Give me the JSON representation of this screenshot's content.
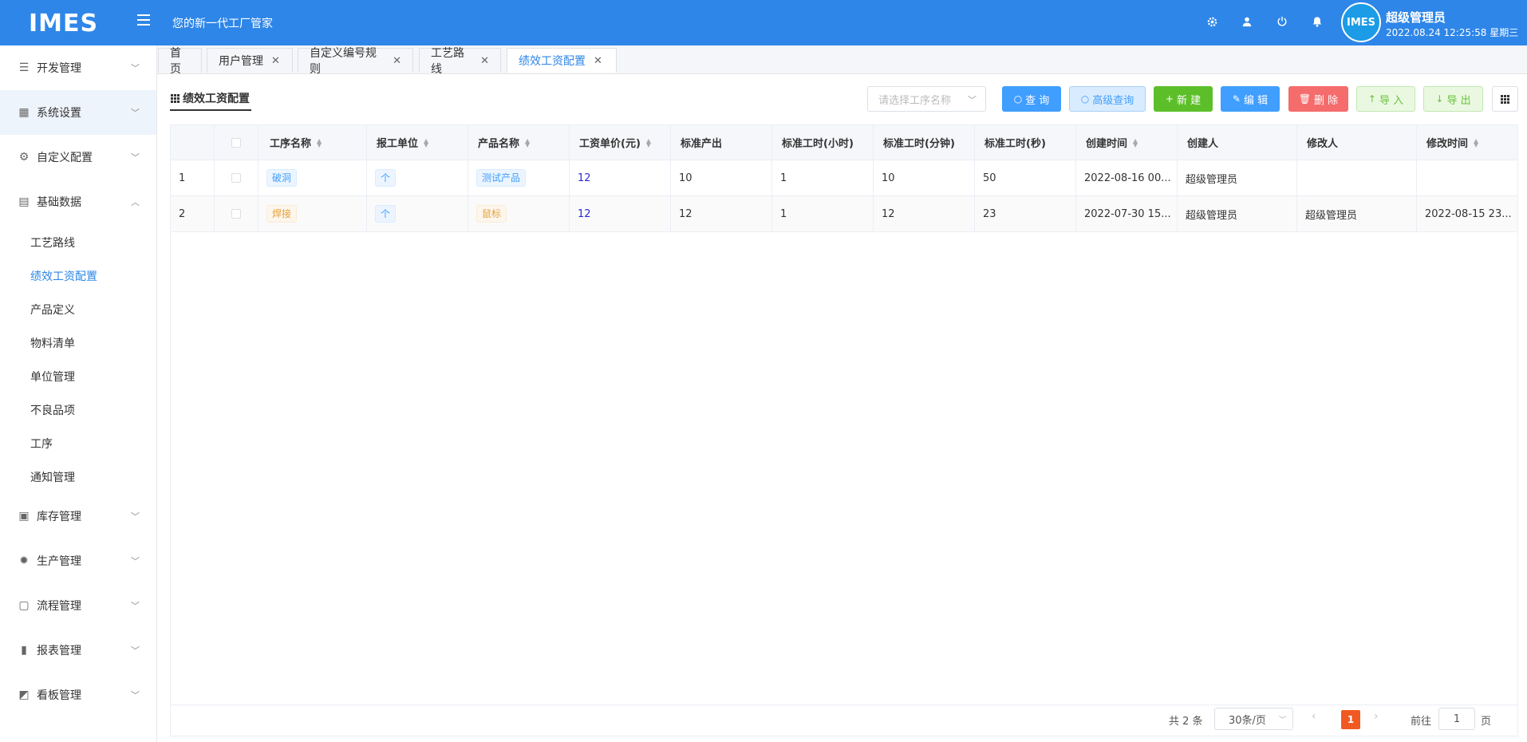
{
  "header": {
    "logo": "IMES",
    "slogan": "您的新一代工厂管家",
    "avatar_text": "IMES",
    "user_name": "超级管理员",
    "datetime": "2022.08.24 12:25:58 星期三",
    "icons": [
      "gear-icon",
      "user-icon",
      "power-icon",
      "bell-icon"
    ]
  },
  "sidebar": {
    "groups": [
      {
        "label": "开发管理",
        "icon": "sliders-icon",
        "expanded": false
      },
      {
        "label": "系统设置",
        "icon": "grid-icon",
        "expanded": false,
        "active": true
      },
      {
        "label": "自定义配置",
        "icon": "gear-icon",
        "expanded": false
      },
      {
        "label": "基础数据",
        "icon": "book-icon",
        "expanded": true
      },
      {
        "label": "库存管理",
        "icon": "clipboard-icon",
        "expanded": false
      },
      {
        "label": "生产管理",
        "icon": "cog-icon",
        "expanded": false
      },
      {
        "label": "流程管理",
        "icon": "flow-icon",
        "expanded": false
      },
      {
        "label": "报表管理",
        "icon": "bar-chart-icon",
        "expanded": false
      },
      {
        "label": "看板管理",
        "icon": "line-chart-icon",
        "expanded": false
      }
    ],
    "sub_items": [
      "工艺路线",
      "绩效工资配置",
      "产品定义",
      "物料清单",
      "单位管理",
      "不良品项",
      "工序",
      "通知管理"
    ],
    "active_sub": "绩效工资配置"
  },
  "tabs": [
    {
      "label": "首页",
      "closable": false
    },
    {
      "label": "用户管理",
      "closable": true
    },
    {
      "label": "自定义编号规则",
      "closable": true
    },
    {
      "label": "工艺路线",
      "closable": true
    },
    {
      "label": "绩效工资配置",
      "closable": true,
      "active": true
    }
  ],
  "page": {
    "title": "绩效工资配置",
    "select_placeholder": "请选择工序名称",
    "buttons": {
      "query": "查 询",
      "advanced_query": "高级查询",
      "create": "新 建",
      "edit": "编 辑",
      "delete": "删 除",
      "import": "导 入",
      "export": "导 出"
    },
    "colors": {
      "query": "#409eff",
      "advanced_query": "#d9ecff",
      "create": "#5cbf2a",
      "edit": "#409eff",
      "delete": "#f56c6c",
      "import": "#e8f8e0",
      "export": "#e8f8e0"
    }
  },
  "table": {
    "columns": [
      "工序名称",
      "报工单位",
      "产品名称",
      "工资单价(元)",
      "标准产出",
      "标准工时(小时)",
      "标准工时(分钟)",
      "标准工时(秒)",
      "创建时间",
      "创建人",
      "修改人",
      "修改时间"
    ],
    "rows": [
      {
        "index": "1",
        "process": "破洞",
        "process_tag": "blue",
        "unit": "个",
        "product": "测试产品",
        "product_tag": "blue",
        "price": "12",
        "output": "10",
        "hours": "1",
        "minutes": "10",
        "seconds": "50",
        "created": "2022-08-16 00...",
        "creator": "超级管理员",
        "modifier": "",
        "modified": ""
      },
      {
        "index": "2",
        "process": "焊接",
        "process_tag": "orange",
        "unit": "个",
        "product": "鼠标",
        "product_tag": "orange",
        "price": "12",
        "output": "12",
        "hours": "1",
        "minutes": "12",
        "seconds": "23",
        "created": "2022-07-30 15...",
        "creator": "超级管理员",
        "modifier": "超级管理员",
        "modified": "2022-08-15 23..."
      }
    ]
  },
  "pagination": {
    "total": "共 2 条",
    "page_size": "30条/页",
    "current": "1",
    "goto_label": "前往",
    "goto_value": "1",
    "page_label": "页"
  }
}
